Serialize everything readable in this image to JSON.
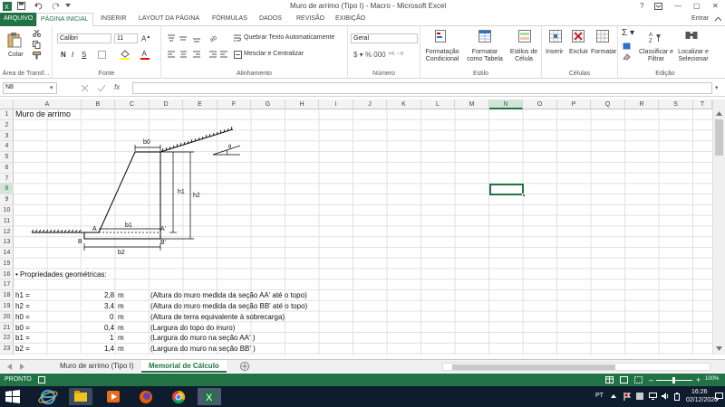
{
  "titlebar": {
    "title": "Muro de arrimo (Tipo I) - Macro - Microsoft Excel",
    "help": "?",
    "min": "—",
    "max": "▢",
    "close": "✕",
    "login": "Entrar"
  },
  "tabs": [
    "ARQUIVO",
    "PÁGINA INICIAL",
    "INSERIR",
    "LAYOUT DA PÁGINA",
    "FÓRMULAS",
    "DADOS",
    "REVISÃO",
    "EXIBIÇÃO"
  ],
  "ribbon": {
    "clipboard": {
      "paste": "Colar",
      "label": "Área de Transf..."
    },
    "font": {
      "name": "Calibri",
      "size": "11",
      "bold": "N",
      "italic": "I",
      "underline": "S",
      "label": "Fonte"
    },
    "alignment": {
      "wrap": "Quebrar Texto Automaticamente",
      "merge": "Mesclar e Centralizar",
      "label": "Alinhamento"
    },
    "number": {
      "format": "Geral",
      "label": "Número"
    },
    "styles": {
      "conditional": "Formatação Condicional",
      "table": "Formatar como Tabela",
      "cell": "Estilos de Célula",
      "label": "Estilo"
    },
    "cells": {
      "insert": "Inserir",
      "delete": "Excluir",
      "format": "Formatar",
      "label": "Células"
    },
    "editing": {
      "sort": "Classificar e Filtrar",
      "find": "Localizar e Selecionar",
      "label": "Edição"
    }
  },
  "formula_bar": {
    "namebox": "N8",
    "fx": "fx",
    "value": ""
  },
  "columns": [
    "A",
    "B",
    "C",
    "D",
    "E",
    "F",
    "G",
    "H",
    "I",
    "J",
    "K",
    "L",
    "M",
    "N",
    "O",
    "P",
    "Q",
    "R",
    "S",
    "T"
  ],
  "selected_column": "N",
  "selected_row": "8",
  "rows": [
    "1",
    "2",
    "3",
    "4",
    "5",
    "6",
    "7",
    "8",
    "9",
    "10",
    "11",
    "12",
    "13",
    "14",
    "15",
    "16",
    "17",
    "18",
    "19",
    "20",
    "21",
    "22",
    "23"
  ],
  "cells": {
    "title": "Muro de arrimo",
    "props_header": "• Propriedades geométricas:",
    "params": [
      {
        "name": "h1 =",
        "value": "2,8",
        "unit": "m",
        "desc": "(Altura do muro medida da seção AA' até o topo)"
      },
      {
        "name": "h2 =",
        "value": "3,4",
        "unit": "m",
        "desc": "(Altura do muro medida da seção BB' até o topo)"
      },
      {
        "name": "h0 =",
        "value": "0",
        "unit": "m",
        "desc": "(Altura de terra equivalente à sobrecarga)"
      },
      {
        "name": "b0 =",
        "value": "0,4",
        "unit": "m",
        "desc": "(Largura do topo do muro)"
      },
      {
        "name": "b1 =",
        "value": "1",
        "unit": "m",
        "desc": "(Largura do muro na seção AA' )"
      },
      {
        "name": "b2 =",
        "value": "1,4",
        "unit": "m",
        "desc": "(Largura do muro na seção BB' )"
      }
    ]
  },
  "diagram": {
    "b0": "b0",
    "b1": "b1",
    "b2": "b2",
    "h1": "h1",
    "h2": "h2",
    "A": "A",
    "A2": "A'",
    "B": "B",
    "B2": "B'",
    "theta": "θ"
  },
  "sheets": [
    "Muro de arrimo (Tipo I)",
    "Memorial de Cálculo"
  ],
  "active_sheet": "Memorial de Cálculo",
  "status": {
    "ready": "PRONTO",
    "zoom": "100%"
  },
  "taskbar": {
    "lang": "PT",
    "time": "16:26",
    "date": "02/12/2020"
  }
}
